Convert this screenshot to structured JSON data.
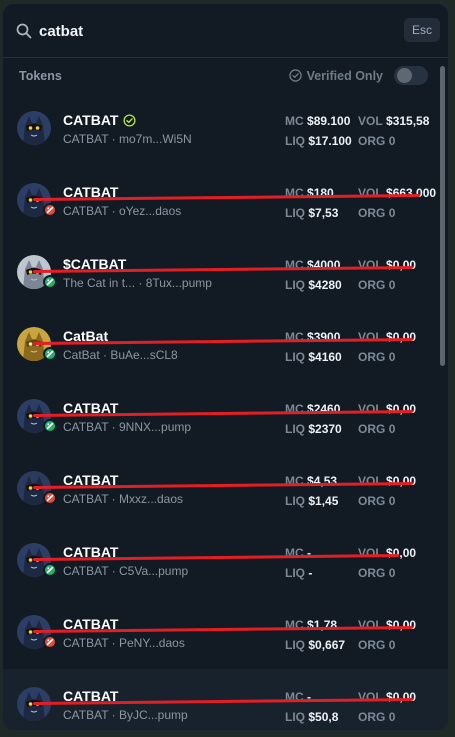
{
  "search": {
    "value": "catbat",
    "esc_label": "Esc"
  },
  "section": {
    "title": "Tokens",
    "verified_label": "Verified Only"
  },
  "labels": {
    "mc": "MC",
    "vol": "VOL",
    "liq": "LIQ",
    "org": "ORG"
  },
  "colors": {
    "badge_red": "#e4493a",
    "badge_green": "#21b36b",
    "verified_green": "#b5e64c",
    "strike": "#e31e25"
  },
  "tokens": [
    {
      "name": "CATBAT",
      "verified": true,
      "sub": "CATBAT · mo7m...Wi5N",
      "mc": "$89.100",
      "vol": "$315,58",
      "liq": "$17.100",
      "org": "0",
      "badge": "",
      "strike": false
    },
    {
      "name": "CATBAT",
      "verified": false,
      "sub": "CATBAT · oYez...daos",
      "mc": "$180",
      "vol": "$663.000",
      "liq": "$7,53",
      "org": "0",
      "badge": "red",
      "strike": true
    },
    {
      "name": "$CATBAT",
      "verified": false,
      "sub": "The Cat in t... · 8Tux...pump",
      "mc": "$4000",
      "vol": "$0,00",
      "liq": "$4280",
      "org": "0",
      "badge": "green",
      "strike": true
    },
    {
      "name": "CatBat",
      "verified": false,
      "sub": "CatBat · BuAe...sCL8",
      "mc": "$3900",
      "vol": "$0,00",
      "liq": "$4160",
      "org": "0",
      "badge": "green",
      "strike": true
    },
    {
      "name": "CATBAT",
      "verified": false,
      "sub": "CATBAT · 9NNX...pump",
      "mc": "$2460",
      "vol": "$0,00",
      "liq": "$2370",
      "org": "0",
      "badge": "green",
      "strike": true
    },
    {
      "name": "CATBAT",
      "verified": false,
      "sub": "CATBAT · Mxxz...daos",
      "mc": "$4,53",
      "vol": "$0,00",
      "liq": "$1,45",
      "org": "0",
      "badge": "red",
      "strike": true
    },
    {
      "name": "CATBAT",
      "verified": false,
      "sub": "CATBAT · C5Va...pump",
      "mc": "-",
      "vol": "$0,00",
      "liq": "-",
      "org": "0",
      "badge": "green",
      "strike": true
    },
    {
      "name": "CATBAT",
      "verified": false,
      "sub": "CATBAT · PeNY...daos",
      "mc": "$1,78",
      "vol": "$0,00",
      "liq": "$0,667",
      "org": "0",
      "badge": "red",
      "strike": true
    },
    {
      "name": "CATBAT",
      "verified": false,
      "sub": "CATBAT · ByJC...pump",
      "mc": "-",
      "vol": "$0,00",
      "liq": "$50,8",
      "org": "0",
      "badge": "",
      "strike": true
    }
  ]
}
